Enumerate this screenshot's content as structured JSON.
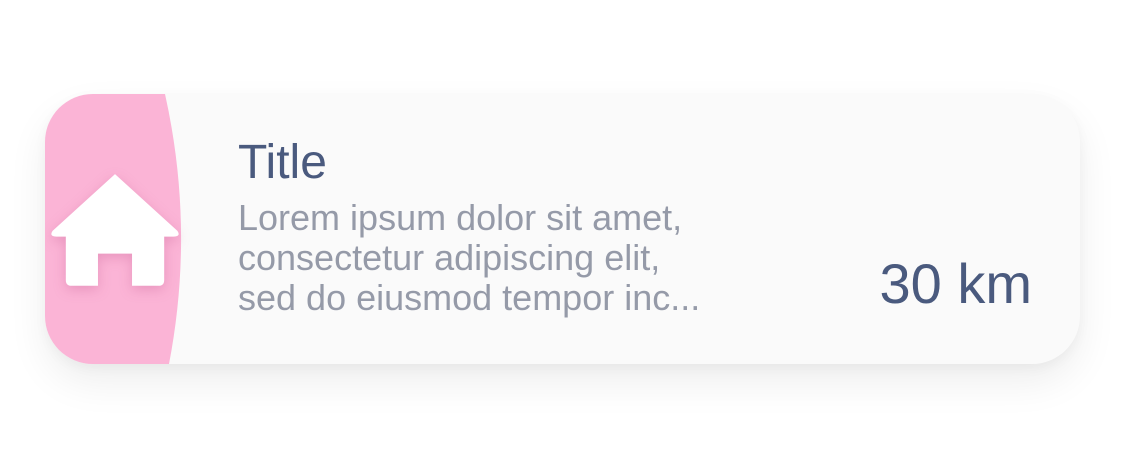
{
  "card": {
    "title": "Title",
    "description_lines": [
      "Lorem ipsum dolor sit amet,",
      "consectetur adipiscing elit,",
      "sed do eiusmod tempor inc..."
    ],
    "distance": "30 km",
    "icon": "home-icon"
  },
  "colors": {
    "accent": "#fbb4d6",
    "title": "#4a5a7e",
    "description": "#959aa8",
    "card_background": "#fafafa"
  }
}
